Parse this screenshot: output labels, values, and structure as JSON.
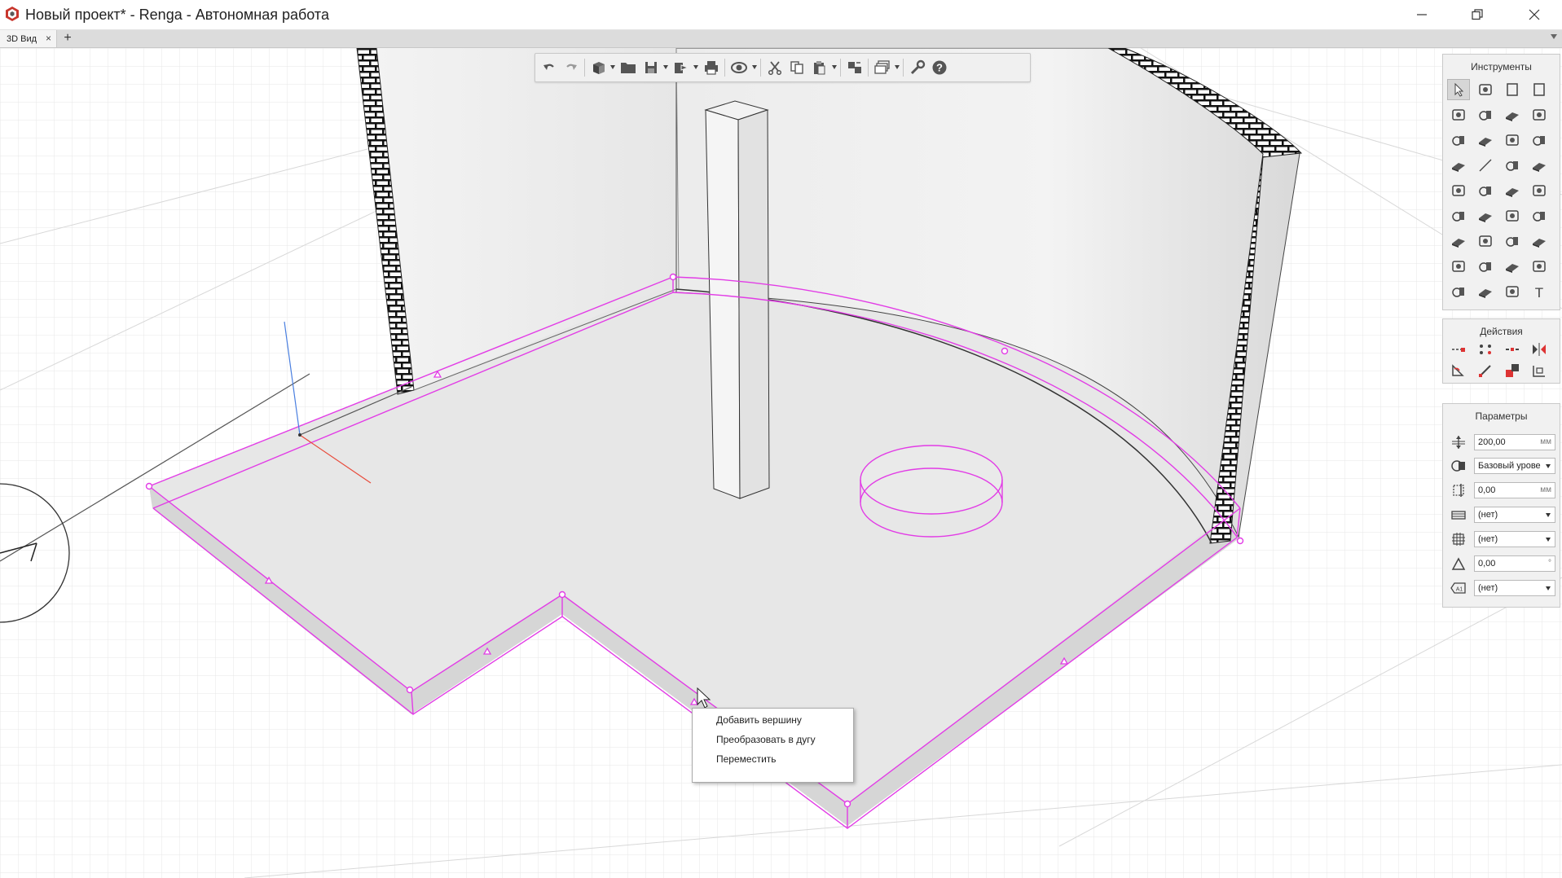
{
  "window": {
    "title": "Новый проект* - Renga - Автономная работа"
  },
  "tabs": {
    "items": [
      {
        "label": "3D Вид"
      }
    ],
    "close_glyph": "×",
    "add_glyph": "+"
  },
  "toolbar": {
    "buttons": [
      "undo-icon",
      "redo-icon",
      "views-icon",
      "open-icon",
      "save-icon",
      "export-icon",
      "print-icon",
      "render-icon",
      "cut-icon",
      "copy-icon",
      "paste-icon",
      "sync-icon",
      "layers-icon",
      "settings-wrench-icon",
      "help-icon"
    ]
  },
  "panels": {
    "tools": {
      "title": "Инструменты",
      "selected": "select-tool"
    },
    "actions": {
      "title": "Действия"
    },
    "params": {
      "title": "Параметры",
      "fields": {
        "thickness": {
          "value": "200,00",
          "unit": "мм"
        },
        "level": {
          "value": "Базовый урове"
        },
        "offset": {
          "value": "0,00",
          "unit": "мм"
        },
        "material": {
          "value": "(нет)"
        },
        "style": {
          "value": "(нет)"
        },
        "angle": {
          "value": "0,00",
          "unit": "°"
        },
        "label": {
          "value": "(нет)"
        }
      }
    }
  },
  "context_menu": {
    "items": [
      {
        "label": "Добавить вершину"
      },
      {
        "label": "Преобразовать в дугу"
      },
      {
        "label": "Переместить"
      }
    ]
  },
  "colors": {
    "selection": "#e23ce6",
    "axis_x": "#e84a3a",
    "axis_z": "#4a7fe0",
    "floor": "#e3e3e3",
    "grid": "#c6c6c6",
    "panel_bg": "#f1f1f1"
  }
}
